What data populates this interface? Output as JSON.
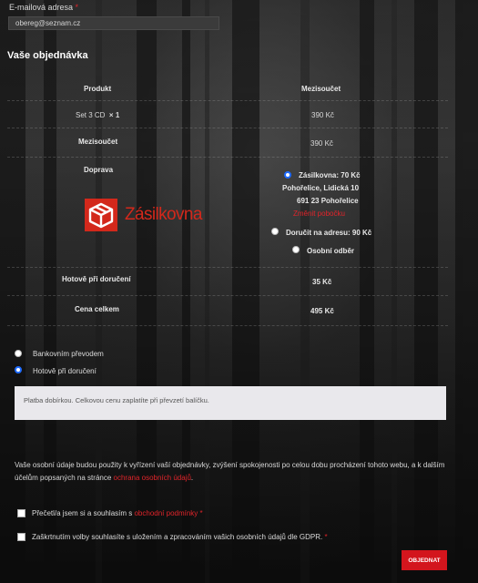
{
  "email": {
    "label": "E-mailová adresa",
    "required_mark": "*",
    "value": "obereg@seznam.cz"
  },
  "order": {
    "title": "Vaše objednávka",
    "headers": {
      "product": "Produkt",
      "subtotal": "Mezisoučet"
    },
    "item": {
      "name": "Set 3 CD",
      "qty": "× 1",
      "price": "390 Kč"
    },
    "subtotal_row": {
      "label": "Mezisoučet",
      "value": "390 Kč"
    },
    "shipping": {
      "label": "Doprava",
      "logo_text": "Zásilkovna",
      "options": [
        {
          "label": "Zásilkovna: 70 Kč",
          "selected": true
        },
        {
          "label": "Doručit na adresu: 90 Kč",
          "selected": false
        },
        {
          "label": "Osobní odběr",
          "selected": false
        }
      ],
      "pickup_line1": "Pohořelice, Lidická 10",
      "pickup_line2": "691 23 Pohořelice",
      "change_link": "Změnit pobočku"
    },
    "cod_row": {
      "label": "Hotově při doručení",
      "value": "35 Kč"
    },
    "total_row": {
      "label": "Cena celkem",
      "value": "495 Kč"
    }
  },
  "payment": {
    "options": [
      {
        "label": "Bankovním převodem",
        "selected": false
      },
      {
        "label": "Hotově při doručení",
        "selected": true
      }
    ],
    "notice": "Platba dobírkou. Celkovou cenu zaplatíte při převzetí balíčku."
  },
  "privacy": {
    "text_before": "Vaše osobní údaje budou použity k vyřízení vaší objednávky, zvýšení spokojenosti po celou dobu procházení tohoto webu, a k dalším účelům popsaných na stránce ",
    "link": "ochrana osobních údajů",
    "text_after": "."
  },
  "consents": {
    "terms_before": "Přečetl/a jsem si a souhlasím s ",
    "terms_link": "obchodní podmínky",
    "terms_required": "*",
    "gdpr": "Zaškrtnutím volby souhlasíte s uložením a zpracováním vašich osobních údajů dle GDPR.",
    "gdpr_required": "*"
  },
  "submit_label": "OBJEDNAT",
  "colors": {
    "accent": "#d3151d",
    "radio_selected": "#1e6bff",
    "notice_bg": "#e9e8ec"
  }
}
